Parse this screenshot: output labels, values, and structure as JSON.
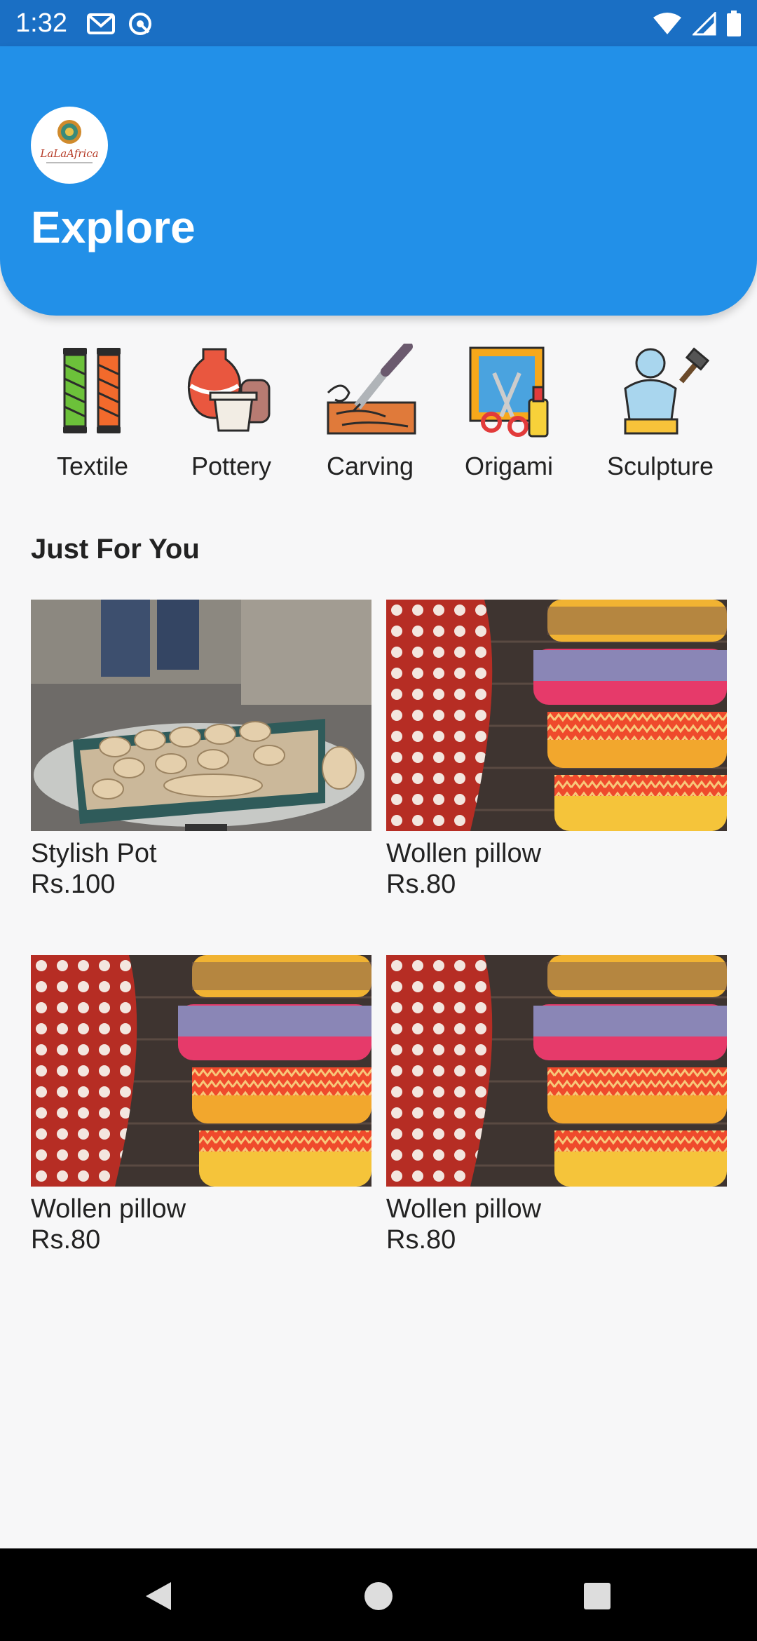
{
  "status": {
    "time": "1:32"
  },
  "header": {
    "title": "Explore",
    "logo_text": "LaLaAfrica"
  },
  "categories": [
    {
      "label": "Textile",
      "icon": "thread-spools-icon"
    },
    {
      "label": "Pottery",
      "icon": "pottery-icon"
    },
    {
      "label": "Carving",
      "icon": "wood-carving-icon"
    },
    {
      "label": "Origami",
      "icon": "origami-scissors-icon"
    },
    {
      "label": "Sculpture",
      "icon": "sculpture-bust-icon"
    }
  ],
  "section": {
    "title": "Just For You"
  },
  "products": [
    {
      "name": "Stylish Pot",
      "price": "Rs.100",
      "image": "pottery-photo"
    },
    {
      "name": "Wollen pillow",
      "price": "Rs.80",
      "image": "pillow-photo"
    },
    {
      "name": "Wollen pillow",
      "price": "Rs.80",
      "image": "pillow-photo"
    },
    {
      "name": "Wollen pillow",
      "price": "Rs.80",
      "image": "pillow-photo"
    }
  ],
  "colors": {
    "header": "#2290e8",
    "statusbar": "#1a6fc4"
  }
}
